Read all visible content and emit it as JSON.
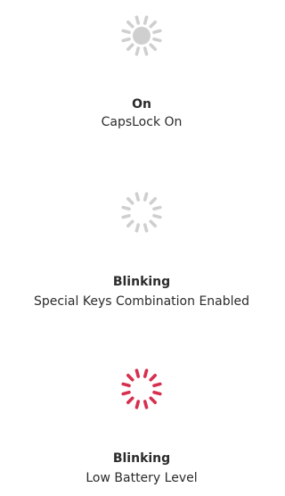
{
  "indicators": [
    {
      "state": "On",
      "description": "CapsLock On",
      "icon": "led-on-icon",
      "color": "#cfcfcf",
      "center_dot": true
    },
    {
      "state": "Blinking",
      "description": "Special Keys Combination Enabled",
      "icon": "led-blinking-icon",
      "color": "#cfcfcf",
      "center_dot": false
    },
    {
      "state": "Blinking",
      "description": "Low Battery Level",
      "icon": "led-blinking-icon",
      "color": "#d6304e",
      "center_dot": false
    }
  ]
}
